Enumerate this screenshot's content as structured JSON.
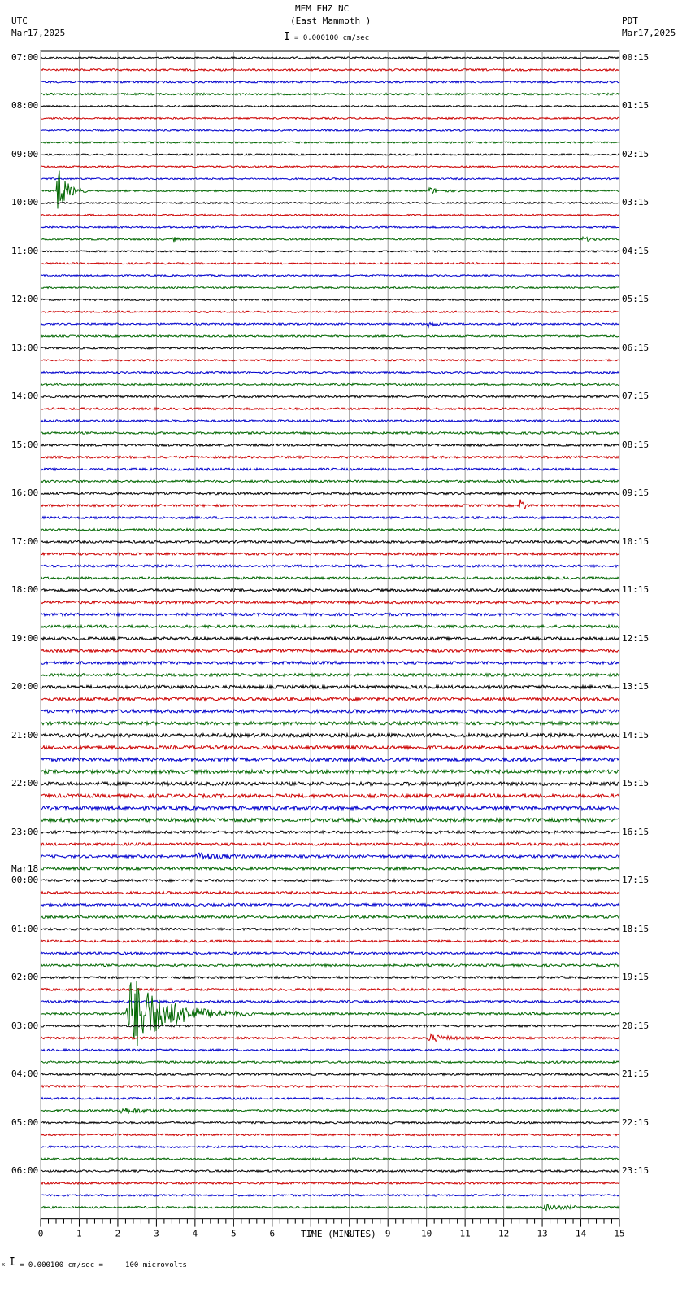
{
  "header": {
    "station": "MEM EHZ NC",
    "location": "(East Mammoth )",
    "left_tz": "UTC",
    "left_date": "Mar17,2025",
    "right_tz": "PDT",
    "right_date": "Mar17,2025",
    "scale": "= 0.000100 cm/sec"
  },
  "footer": {
    "scale": "= 0.000100 cm/sec =     100 microvolts",
    "mark": "x"
  },
  "chart_data": {
    "type": "line",
    "title": "MEM EHZ NC (East Mammoth )",
    "xlabel": "TIME (MINUTES)",
    "xlim": [
      0,
      15
    ],
    "xticks": [
      0,
      1,
      2,
      3,
      4,
      5,
      6,
      7,
      8,
      9,
      10,
      11,
      12,
      13,
      14,
      15
    ],
    "traces_per_hour": 4,
    "trace_colors": [
      "#000000",
      "#cc0000",
      "#0000cc",
      "#006600"
    ],
    "left_hour_labels": [
      "07:00",
      "08:00",
      "09:00",
      "10:00",
      "11:00",
      "12:00",
      "13:00",
      "14:00",
      "15:00",
      "16:00",
      "17:00",
      "18:00",
      "19:00",
      "20:00",
      "21:00",
      "22:00",
      "23:00",
      "00:00",
      "01:00",
      "02:00",
      "03:00",
      "04:00",
      "05:00",
      "06:00"
    ],
    "date_change_label": "Mar18",
    "date_change_index": 17,
    "right_hour_labels": [
      "00:15",
      "01:15",
      "02:15",
      "03:15",
      "04:15",
      "05:15",
      "06:15",
      "07:15",
      "08:15",
      "09:15",
      "10:15",
      "11:15",
      "12:15",
      "13:15",
      "14:15",
      "15:15",
      "16:15",
      "17:15",
      "18:15",
      "19:15",
      "20:15",
      "21:15",
      "22:15",
      "23:15"
    ],
    "hourly_noise": [
      1.2,
      1.0,
      1.0,
      1.0,
      1.0,
      1.1,
      1.1,
      1.3,
      1.4,
      1.4,
      1.5,
      1.7,
      1.8,
      2.0,
      2.2,
      2.2,
      1.7,
      1.5,
      1.4,
      1.4,
      1.3,
      1.3,
      1.2,
      1.2
    ],
    "events": [
      {
        "trace": 11,
        "start_min": 0.4,
        "end_min": 1.2,
        "amplitude": 40
      },
      {
        "trace": 11,
        "start_min": 10.0,
        "end_min": 11.0,
        "amplitude": 5
      },
      {
        "trace": 15,
        "start_min": 3.4,
        "end_min": 3.9,
        "amplitude": 4
      },
      {
        "trace": 15,
        "start_min": 14.0,
        "end_min": 15.0,
        "amplitude": 3
      },
      {
        "trace": 22,
        "start_min": 10.0,
        "end_min": 10.8,
        "amplitude": 4
      },
      {
        "trace": 37,
        "start_min": 12.4,
        "end_min": 12.7,
        "amplitude": 18
      },
      {
        "trace": 66,
        "start_min": 4.0,
        "end_min": 6.0,
        "amplitude": 5
      },
      {
        "trace": 79,
        "start_min": 2.2,
        "end_min": 5.5,
        "amplitude": 60
      },
      {
        "trace": 81,
        "start_min": 10.0,
        "end_min": 11.6,
        "amplitude": 5
      },
      {
        "trace": 87,
        "start_min": 2.0,
        "end_min": 3.6,
        "amplitude": 6
      },
      {
        "trace": 95,
        "start_min": 13.0,
        "end_min": 15.0,
        "amplitude": 4
      }
    ]
  }
}
